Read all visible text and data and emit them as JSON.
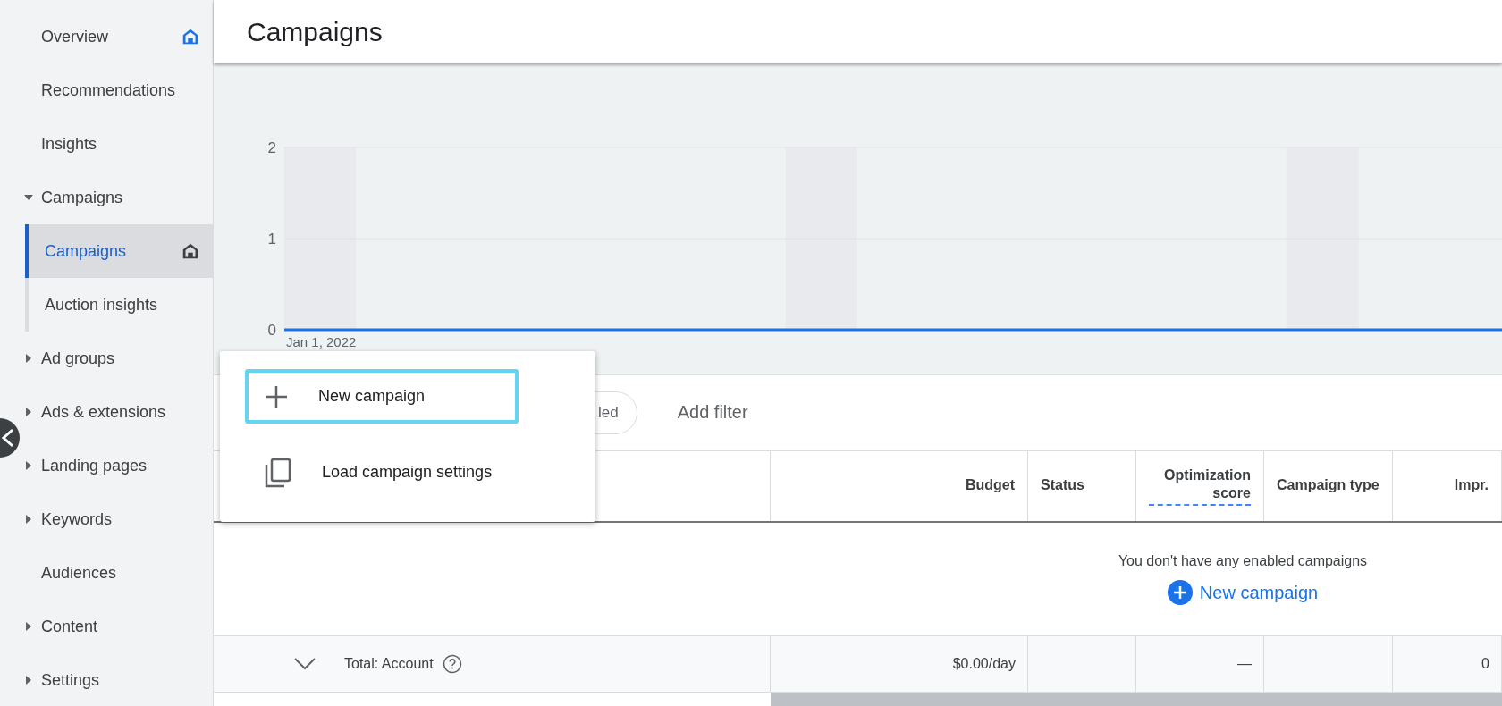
{
  "sidebar": {
    "items": [
      {
        "label": "Overview",
        "kind": "plain",
        "icon": {
          "kind": "home",
          "color": "#1a73e8"
        }
      },
      {
        "label": "Recommendations",
        "kind": "plain"
      },
      {
        "label": "Insights",
        "kind": "plain"
      },
      {
        "label": "Campaigns",
        "kind": "expandable",
        "expanded": true,
        "children": [
          {
            "label": "Campaigns",
            "selected": true,
            "icon": {
              "kind": "home",
              "color": "#3c4043"
            }
          },
          {
            "label": "Auction insights",
            "selected": false
          }
        ]
      },
      {
        "label": "Ad groups",
        "kind": "expandable",
        "expanded": false
      },
      {
        "label": "Ads & extensions",
        "kind": "expandable",
        "expanded": false
      },
      {
        "label": "Landing pages",
        "kind": "expandable",
        "expanded": false
      },
      {
        "label": "Keywords",
        "kind": "expandable",
        "expanded": false
      },
      {
        "label": "Audiences",
        "kind": "plain"
      },
      {
        "label": "Content",
        "kind": "expandable",
        "expanded": false
      },
      {
        "label": "Settings",
        "kind": "expandable",
        "expanded": false
      }
    ]
  },
  "header": {
    "title": "Campaigns"
  },
  "chart_data": {
    "type": "line",
    "annotations": [
      {
        "text": "Jan 1, 2022"
      }
    ],
    "yticks": [
      0,
      1,
      2
    ],
    "ylim": [
      0,
      2
    ],
    "series": [
      {
        "color": "#1a73e8",
        "values": [
          0,
          0,
          0,
          0,
          0,
          0,
          0,
          0,
          0,
          0,
          0,
          0,
          0,
          0,
          0,
          0,
          0
        ]
      }
    ]
  },
  "filters": {
    "chip": "led",
    "add_filter": "Add filter"
  },
  "menu": {
    "items": [
      {
        "label": "New campaign",
        "kind": "plus",
        "focused": true
      },
      {
        "label": "Load campaign settings",
        "kind": "copy",
        "focused": false
      }
    ]
  },
  "table": {
    "columns": [
      {
        "kind": "name"
      },
      {
        "label": "Budget",
        "kind": "number"
      },
      {
        "label": "Status",
        "kind": "text"
      },
      {
        "label": "Optimization score",
        "kind": "number",
        "tooltip": true
      },
      {
        "label": "Campaign type",
        "kind": "text"
      },
      {
        "label": "Impr.",
        "kind": "number"
      }
    ],
    "empty_message": "You don't have any enabled campaigns",
    "empty_action": "New campaign",
    "total_row": {
      "label": "Total: Account",
      "cells": [
        "$0.00/day",
        "",
        "—",
        "",
        "0"
      ]
    }
  }
}
